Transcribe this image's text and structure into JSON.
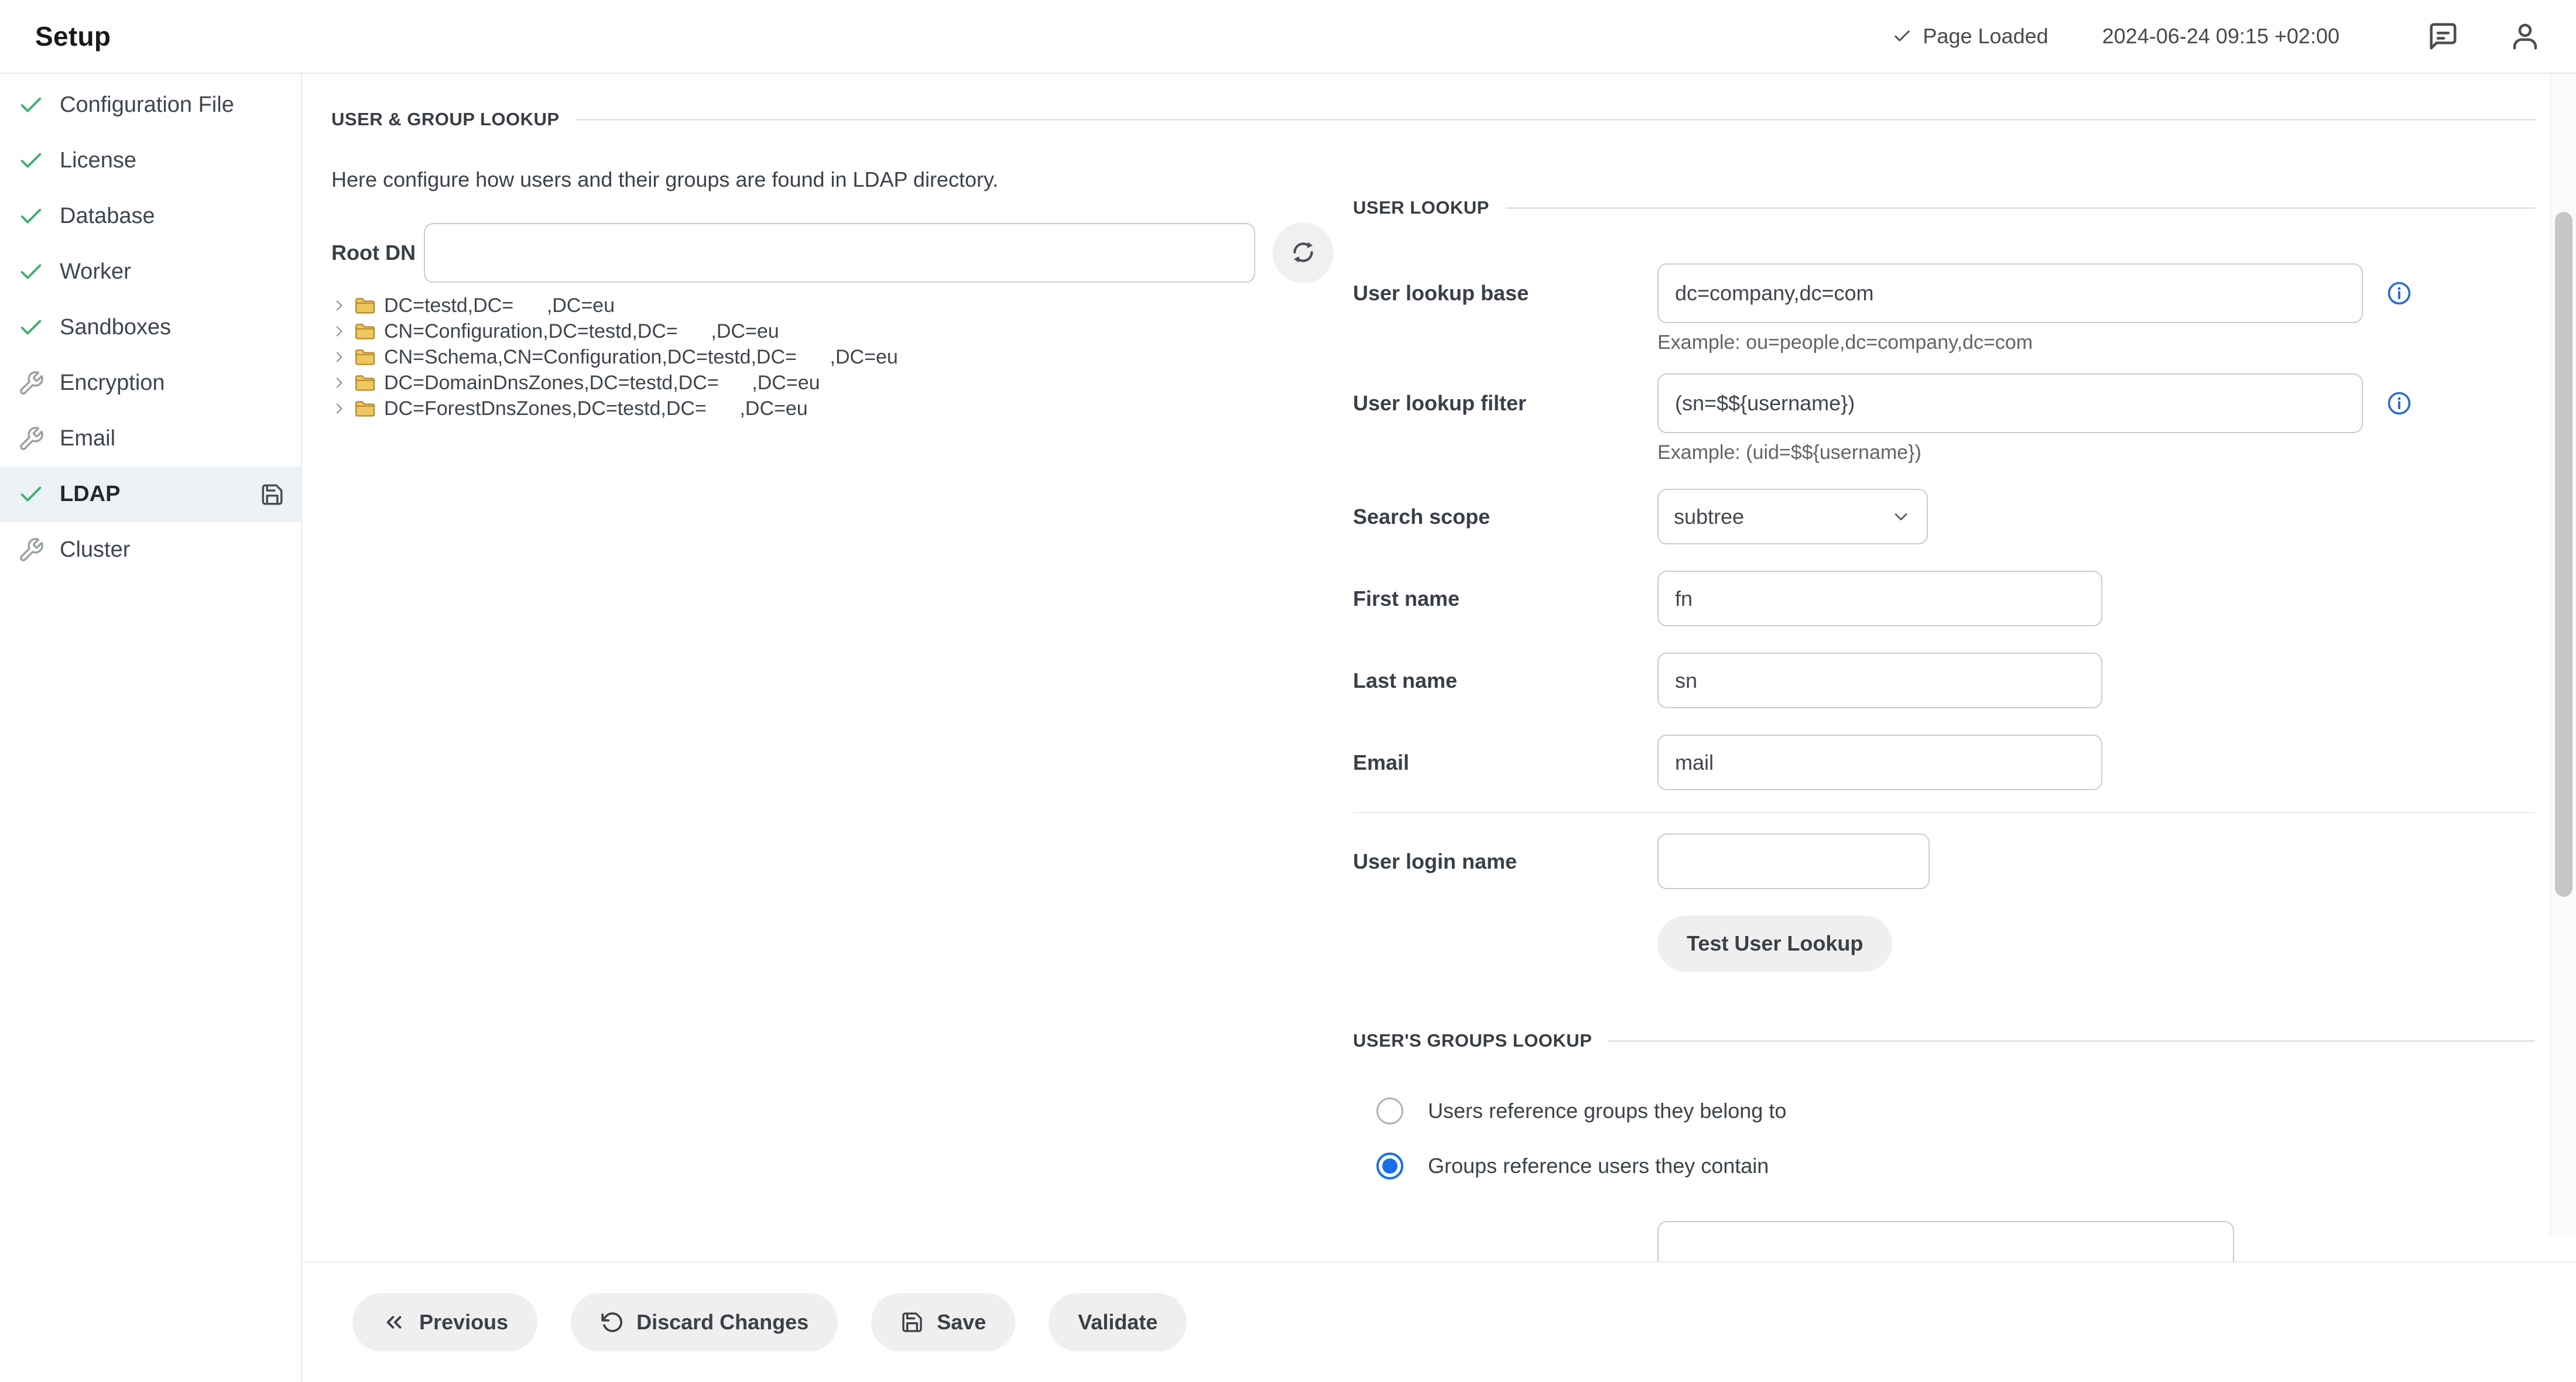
{
  "header": {
    "title": "Setup",
    "status_label": "Page Loaded",
    "timestamp": "2024-06-24 09:15 +02:00"
  },
  "sidebar": {
    "items": [
      {
        "label": "Configuration File",
        "icon": "check"
      },
      {
        "label": "License",
        "icon": "check"
      },
      {
        "label": "Database",
        "icon": "check"
      },
      {
        "label": "Worker",
        "icon": "check"
      },
      {
        "label": "Sandboxes",
        "icon": "check"
      },
      {
        "label": "Encryption",
        "icon": "wrench"
      },
      {
        "label": "Email",
        "icon": "wrench"
      },
      {
        "label": "LDAP",
        "icon": "check",
        "selected": true,
        "trailing_icon": "save"
      },
      {
        "label": "Cluster",
        "icon": "wrench"
      }
    ]
  },
  "main": {
    "section_title": "USER & GROUP LOOKUP",
    "description": "Here configure how users and their groups are found in LDAP directory.",
    "root_dn_label": "Root DN",
    "root_dn_value": "",
    "tree": [
      "DC=testd,DC=      ,DC=eu",
      "CN=Configuration,DC=testd,DC=      ,DC=eu",
      "CN=Schema,CN=Configuration,DC=testd,DC=      ,DC=eu",
      "DC=DomainDnsZones,DC=testd,DC=      ,DC=eu",
      "DC=ForestDnsZones,DC=testd,DC=      ,DC=eu"
    ]
  },
  "user_lookup": {
    "section_title": "USER LOOKUP",
    "base": {
      "label": "User lookup base",
      "value": "dc=company,dc=com",
      "example": "Example: ou=people,dc=company,dc=com"
    },
    "filter": {
      "label": "User lookup filter",
      "value": "(sn=$${username})",
      "example": "Example: (uid=$${username})"
    },
    "scope": {
      "label": "Search scope",
      "value": "subtree"
    },
    "first_name": {
      "label": "First name",
      "value": "fn"
    },
    "last_name": {
      "label": "Last name",
      "value": "sn"
    },
    "email": {
      "label": "Email",
      "value": "mail"
    },
    "login": {
      "label": "User login name",
      "value": ""
    },
    "test_button": "Test User Lookup"
  },
  "groups_lookup": {
    "section_title": "USER'S GROUPS LOOKUP",
    "options": [
      {
        "label": "Users reference groups they belong to",
        "selected": false
      },
      {
        "label": "Groups reference users they contain",
        "selected": true
      }
    ]
  },
  "footer": {
    "previous": "Previous",
    "discard": "Discard Changes",
    "save": "Save",
    "validate": "Validate"
  },
  "colors": {
    "accent_blue": "#1a6fe8",
    "check_green": "#3cb06a",
    "folder_gold": "#f0c75e",
    "selected_row_bg": "#edf2f7"
  }
}
